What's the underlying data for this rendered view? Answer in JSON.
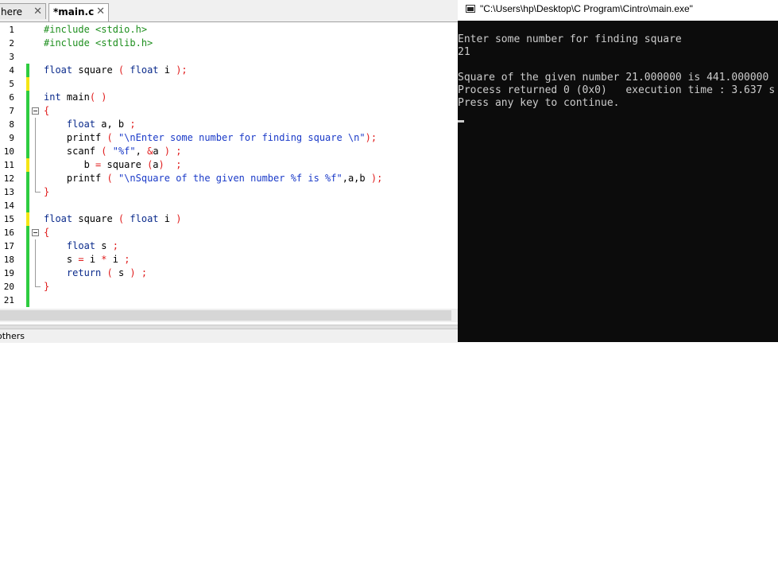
{
  "editor": {
    "tabs": [
      {
        "label": "here",
        "active": false
      },
      {
        "label": "*main.c",
        "active": true
      }
    ],
    "close_glyph": "✕",
    "lines": [
      {
        "n": "1",
        "marker": "none",
        "fold": "none",
        "tokens": [
          {
            "t": "#include <stdio.h>",
            "c": "pp"
          }
        ]
      },
      {
        "n": "2",
        "marker": "none",
        "fold": "none",
        "tokens": [
          {
            "t": "#include <stdlib.h>",
            "c": "pp"
          }
        ]
      },
      {
        "n": "3",
        "marker": "none",
        "fold": "none",
        "tokens": []
      },
      {
        "n": "4",
        "marker": "green",
        "fold": "none",
        "tokens": [
          {
            "t": "float",
            "c": "kw"
          },
          {
            "t": " square ",
            "c": "plain"
          },
          {
            "t": "(",
            "c": "op"
          },
          {
            "t": " ",
            "c": "plain"
          },
          {
            "t": "float",
            "c": "kw"
          },
          {
            "t": " i ",
            "c": "plain"
          },
          {
            "t": ");",
            "c": "op"
          }
        ]
      },
      {
        "n": "5",
        "marker": "yellow",
        "fold": "none",
        "tokens": []
      },
      {
        "n": "6",
        "marker": "green",
        "fold": "none",
        "tokens": [
          {
            "t": "int",
            "c": "kw"
          },
          {
            "t": " main",
            "c": "plain"
          },
          {
            "t": "( )",
            "c": "op"
          }
        ]
      },
      {
        "n": "7",
        "marker": "green",
        "fold": "start",
        "tokens": [
          {
            "t": "{",
            "c": "op"
          }
        ]
      },
      {
        "n": "8",
        "marker": "green",
        "fold": "inner",
        "tokens": [
          {
            "t": "    ",
            "c": "plain"
          },
          {
            "t": "float",
            "c": "kw"
          },
          {
            "t": " a, b ",
            "c": "plain"
          },
          {
            "t": ";",
            "c": "op"
          }
        ]
      },
      {
        "n": "9",
        "marker": "green",
        "fold": "inner",
        "tokens": [
          {
            "t": "    printf ",
            "c": "plain"
          },
          {
            "t": "(",
            "c": "op"
          },
          {
            "t": " ",
            "c": "plain"
          },
          {
            "t": "\"\\nEnter some number for finding square \\n\"",
            "c": "str"
          },
          {
            "t": ");",
            "c": "op"
          }
        ]
      },
      {
        "n": "10",
        "marker": "green",
        "fold": "inner",
        "tokens": [
          {
            "t": "    scanf ",
            "c": "plain"
          },
          {
            "t": "(",
            "c": "op"
          },
          {
            "t": " ",
            "c": "plain"
          },
          {
            "t": "\"%f\"",
            "c": "str"
          },
          {
            "t": ", ",
            "c": "plain"
          },
          {
            "t": "&",
            "c": "op"
          },
          {
            "t": "a ",
            "c": "plain"
          },
          {
            "t": ")",
            "c": "op"
          },
          {
            "t": " ",
            "c": "plain"
          },
          {
            "t": ";",
            "c": "op"
          }
        ]
      },
      {
        "n": "11",
        "marker": "yellow",
        "fold": "inner",
        "tokens": [
          {
            "t": "       b ",
            "c": "plain"
          },
          {
            "t": "=",
            "c": "op"
          },
          {
            "t": " square ",
            "c": "plain"
          },
          {
            "t": "(",
            "c": "op"
          },
          {
            "t": "a",
            "c": "plain"
          },
          {
            "t": ")",
            "c": "op"
          },
          {
            "t": "  ",
            "c": "plain"
          },
          {
            "t": ";",
            "c": "op"
          }
        ]
      },
      {
        "n": "12",
        "marker": "green",
        "fold": "inner",
        "tokens": [
          {
            "t": "    printf ",
            "c": "plain"
          },
          {
            "t": "(",
            "c": "op"
          },
          {
            "t": " ",
            "c": "plain"
          },
          {
            "t": "\"\\nSquare of the given number %f is %f\"",
            "c": "str"
          },
          {
            "t": ",a,b ",
            "c": "plain"
          },
          {
            "t": ");",
            "c": "op"
          }
        ]
      },
      {
        "n": "13",
        "marker": "green",
        "fold": "end",
        "tokens": [
          {
            "t": "}",
            "c": "op"
          }
        ]
      },
      {
        "n": "14",
        "marker": "green",
        "fold": "none",
        "tokens": []
      },
      {
        "n": "15",
        "marker": "yellow",
        "fold": "none",
        "tokens": [
          {
            "t": "float",
            "c": "kw"
          },
          {
            "t": " square ",
            "c": "plain"
          },
          {
            "t": "(",
            "c": "op"
          },
          {
            "t": " ",
            "c": "plain"
          },
          {
            "t": "float",
            "c": "kw"
          },
          {
            "t": " i ",
            "c": "plain"
          },
          {
            "t": ")",
            "c": "op"
          }
        ]
      },
      {
        "n": "16",
        "marker": "green",
        "fold": "start",
        "tokens": [
          {
            "t": "{",
            "c": "op"
          }
        ]
      },
      {
        "n": "17",
        "marker": "green",
        "fold": "inner",
        "tokens": [
          {
            "t": "    ",
            "c": "plain"
          },
          {
            "t": "float",
            "c": "kw"
          },
          {
            "t": " s ",
            "c": "plain"
          },
          {
            "t": ";",
            "c": "op"
          }
        ]
      },
      {
        "n": "18",
        "marker": "green",
        "fold": "inner",
        "tokens": [
          {
            "t": "    s ",
            "c": "plain"
          },
          {
            "t": "=",
            "c": "op"
          },
          {
            "t": " i ",
            "c": "plain"
          },
          {
            "t": "*",
            "c": "op"
          },
          {
            "t": " i ",
            "c": "plain"
          },
          {
            "t": ";",
            "c": "op"
          }
        ]
      },
      {
        "n": "19",
        "marker": "green",
        "fold": "inner",
        "tokens": [
          {
            "t": "    ",
            "c": "plain"
          },
          {
            "t": "return",
            "c": "kw"
          },
          {
            "t": " ",
            "c": "plain"
          },
          {
            "t": "(",
            "c": "op"
          },
          {
            "t": " s ",
            "c": "plain"
          },
          {
            "t": ")",
            "c": "op"
          },
          {
            "t": " ",
            "c": "plain"
          },
          {
            "t": ";",
            "c": "op"
          }
        ]
      },
      {
        "n": "20",
        "marker": "green",
        "fold": "end",
        "tokens": [
          {
            "t": "}",
            "c": "op"
          }
        ]
      },
      {
        "n": "21",
        "marker": "green",
        "fold": "none",
        "tokens": []
      }
    ],
    "bottom_tab_label": "others"
  },
  "console": {
    "title": "\"C:\\Users\\hp\\Desktop\\C Program\\Cintro\\main.exe\"",
    "lines": [
      "Enter some number for finding square",
      "21",
      "",
      "Square of the given number 21.000000 is 441.000000",
      "Process returned 0 (0x0)   execution time : 3.637 s",
      "Press any key to continue."
    ]
  },
  "colors": {
    "keyword": "#0b2b8c",
    "preprocessor": "#1e8f1e",
    "string": "#1a3ac8",
    "operator": "#e01b1b",
    "change_saved": "#2ecc40",
    "change_unsaved": "#f5e616",
    "console_bg": "#0c0c0c",
    "console_text": "#cccccc"
  }
}
